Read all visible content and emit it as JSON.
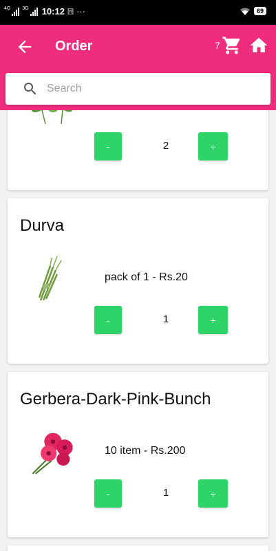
{
  "status_bar": {
    "network_1": "4G",
    "network_2": "3G",
    "time": "10:12",
    "notification_glyph": "回",
    "more": "···",
    "battery": "69"
  },
  "app_bar": {
    "title": "Order",
    "cart_count": "7",
    "icons": {
      "back": "arrow-back-icon",
      "cart": "cart-icon",
      "home": "home-icon"
    },
    "color": "#f02d7d"
  },
  "search": {
    "placeholder": "Search",
    "value": ""
  },
  "accent_colors": {
    "button_green": "#2ed468"
  },
  "items": [
    {
      "name": "",
      "description": "",
      "quantity": "2",
      "minus_label": "-",
      "plus_label": "+",
      "image": "flower-icon"
    },
    {
      "name": "Durva",
      "description": "pack of 1 - Rs.20",
      "quantity": "1",
      "minus_label": "-",
      "plus_label": "+",
      "image": "durva-grass-icon"
    },
    {
      "name": "Gerbera-Dark-Pink-Bunch",
      "description": "10 item - Rs.200",
      "quantity": "1",
      "minus_label": "-",
      "plus_label": "+",
      "image": "gerbera-bunch-icon"
    }
  ]
}
